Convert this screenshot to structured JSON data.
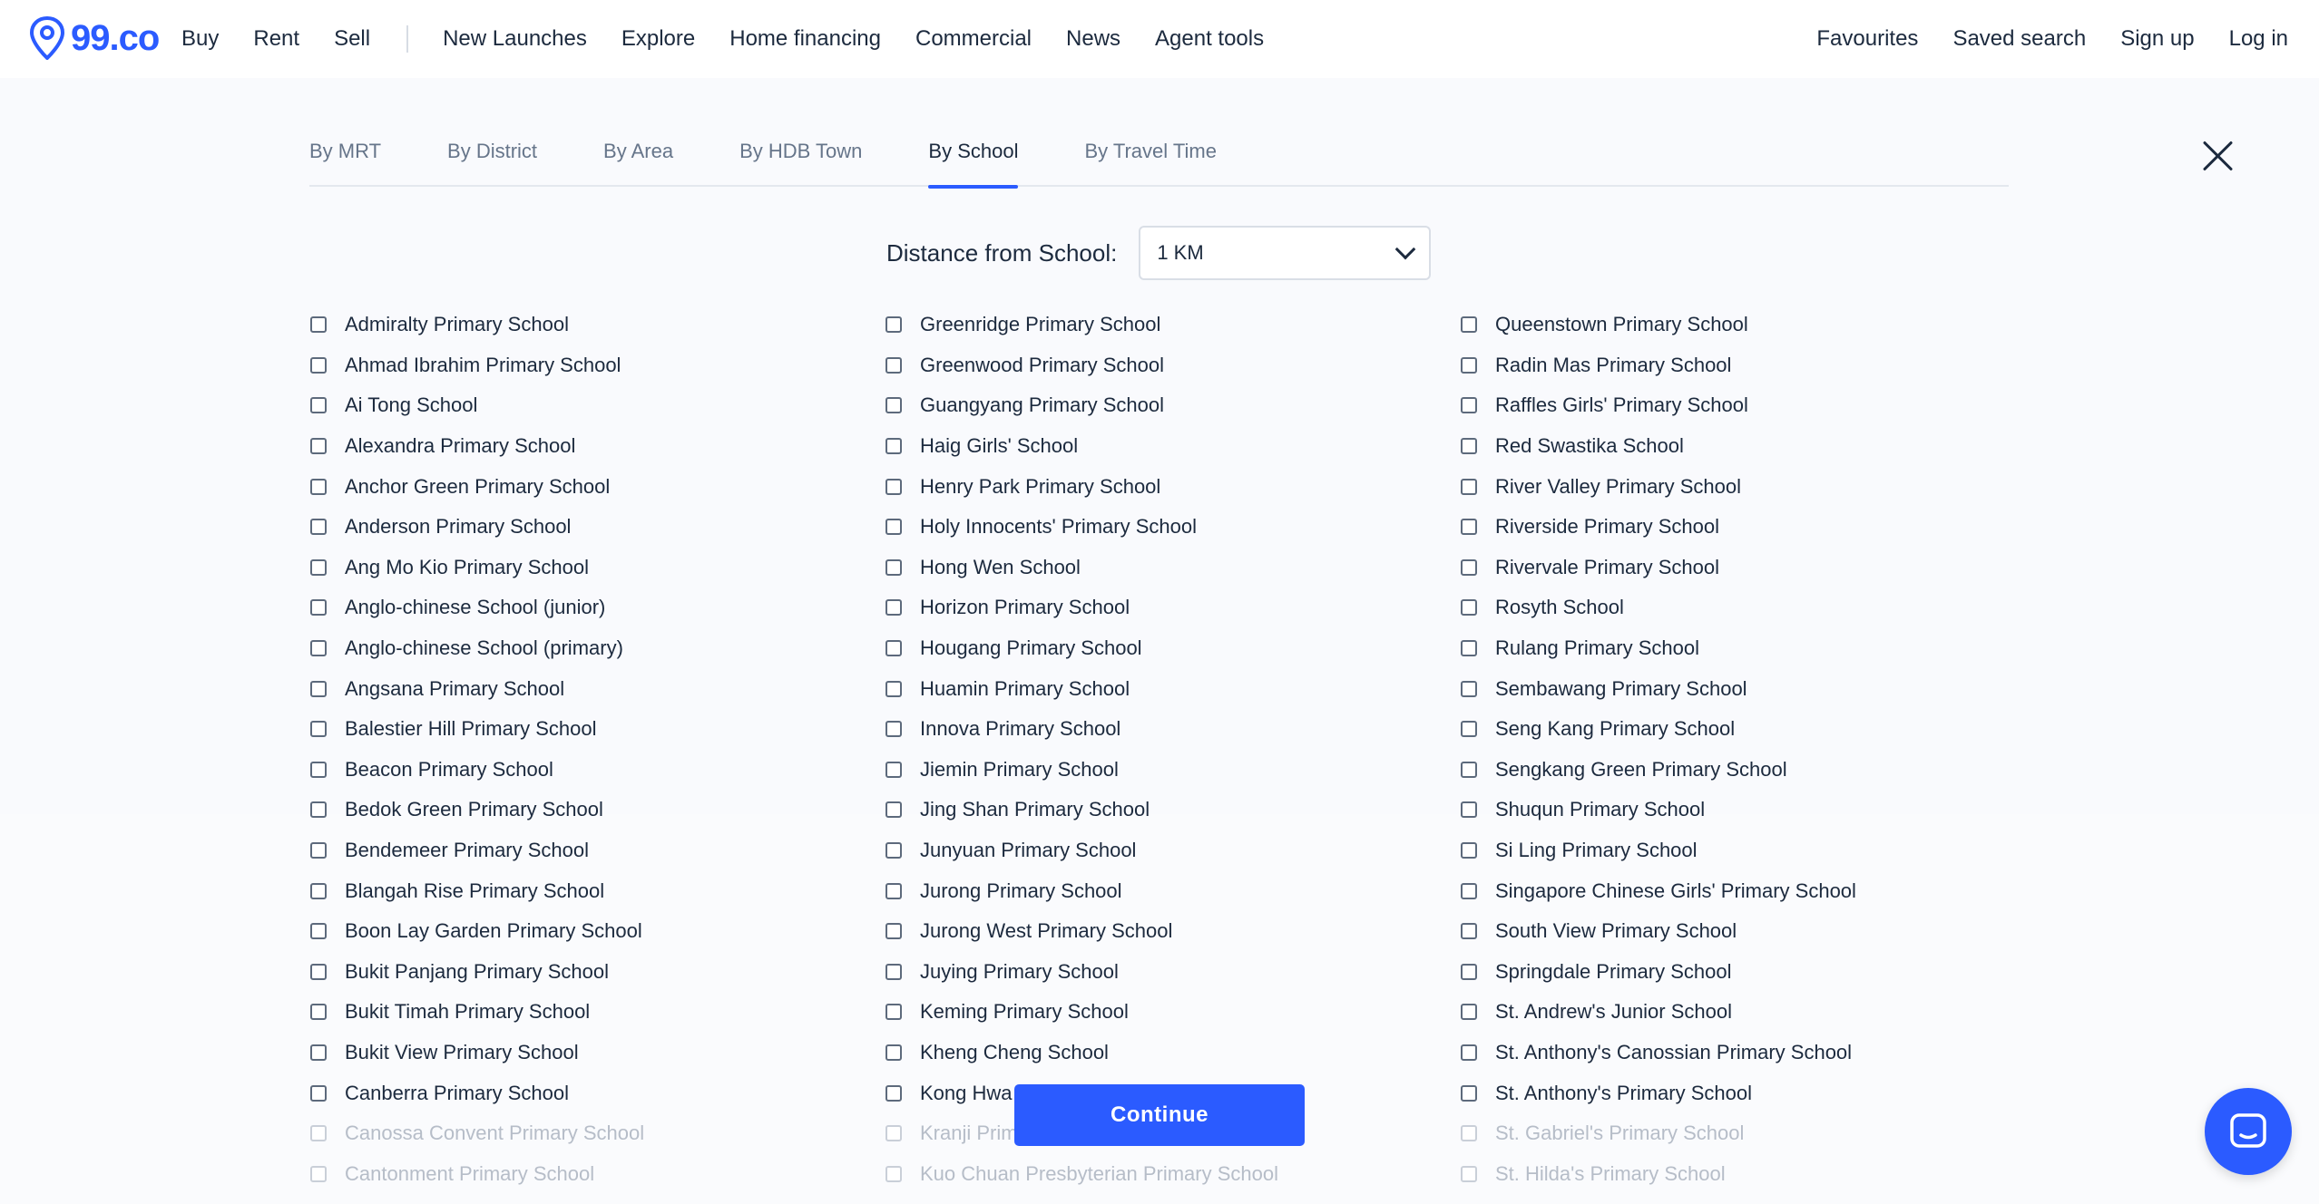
{
  "brand": {
    "logo_text": "99.co",
    "accent": "#2b5bff"
  },
  "nav": {
    "left": [
      "Buy",
      "Rent",
      "Sell",
      "New Launches",
      "Explore",
      "Home financing",
      "Commercial",
      "News",
      "Agent tools"
    ],
    "right": [
      "Favourites",
      "Saved search",
      "Sign up",
      "Log in"
    ]
  },
  "tabs": [
    {
      "label": "By MRT",
      "active": false
    },
    {
      "label": "By District",
      "active": false
    },
    {
      "label": "By Area",
      "active": false
    },
    {
      "label": "By HDB Town",
      "active": false
    },
    {
      "label": "By School",
      "active": true
    },
    {
      "label": "By Travel Time",
      "active": false
    }
  ],
  "distance": {
    "label": "Distance from School:",
    "selected": "1 KM"
  },
  "schools": {
    "col1": [
      "Admiralty Primary School",
      "Ahmad Ibrahim Primary School",
      "Ai Tong School",
      "Alexandra Primary School",
      "Anchor Green Primary School",
      "Anderson Primary School",
      "Ang Mo Kio Primary School",
      "Anglo-chinese School (junior)",
      "Anglo-chinese School (primary)",
      "Angsana Primary School",
      "Balestier Hill Primary School",
      "Beacon Primary School",
      "Bedok Green Primary School",
      "Bendemeer Primary School",
      "Blangah Rise Primary School",
      "Boon Lay Garden Primary School",
      "Bukit Panjang Primary School",
      "Bukit Timah Primary School",
      "Bukit View Primary School",
      "Canberra Primary School",
      "Canossa Convent Primary School",
      "Cantonment Primary School"
    ],
    "col2": [
      "Greenridge Primary School",
      "Greenwood Primary School",
      "Guangyang Primary School",
      "Haig Girls' School",
      "Henry Park Primary School",
      "Holy Innocents' Primary School",
      "Hong Wen School",
      "Horizon Primary School",
      "Hougang Primary School",
      "Huamin Primary School",
      "Innova Primary School",
      "Jiemin Primary School",
      "Jing Shan Primary School",
      "Junyuan Primary School",
      "Jurong Primary School",
      "Jurong West Primary School",
      "Juying Primary School",
      "Keming Primary School",
      "Kheng Cheng School",
      "Kong Hwa School",
      "Kranji Primary School",
      "Kuo Chuan Presbyterian Primary School"
    ],
    "col3": [
      "Queenstown Primary School",
      "Radin Mas Primary School",
      "Raffles Girls' Primary School",
      "Red Swastika School",
      "River Valley Primary School",
      "Riverside Primary School",
      "Rivervale Primary School",
      "Rosyth School",
      "Rulang Primary School",
      "Sembawang Primary School",
      "Seng Kang Primary School",
      "Sengkang Green Primary School",
      "Shuqun Primary School",
      "Si Ling Primary School",
      "Singapore Chinese Girls' Primary School",
      "South View Primary School",
      "Springdale Primary School",
      "St. Andrew's Junior School",
      "St. Anthony's Canossian Primary School",
      "St. Anthony's Primary School",
      "St. Gabriel's Primary School",
      "St. Hilda's Primary School"
    ]
  },
  "continue_label": "Continue",
  "icons": {
    "close": "close-icon",
    "chat": "chat-icon",
    "dropdown": "chevron-down-icon"
  }
}
